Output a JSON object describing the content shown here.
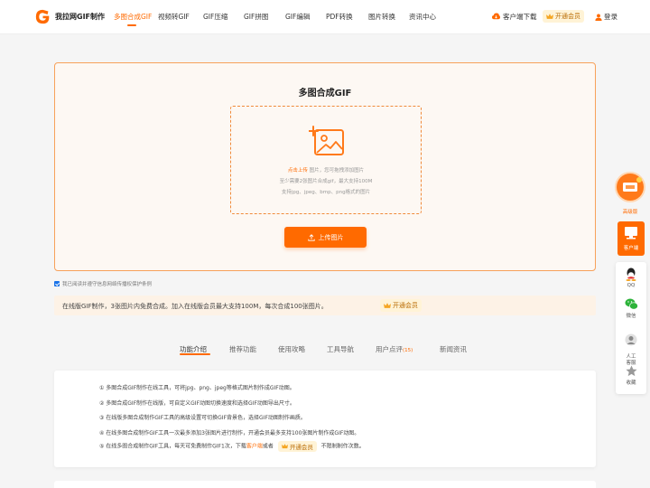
{
  "header": {
    "logo_text": "我拉网GIF制作",
    "nav": [
      {
        "label": "多图合成GIF",
        "active": true
      },
      {
        "label": "视频转GIF",
        "active": false
      },
      {
        "label": "GIF压缩",
        "active": false
      },
      {
        "label": "GIF拼图",
        "active": false
      },
      {
        "label": "GIF编辑",
        "active": false
      },
      {
        "label": "PDF转换",
        "active": false
      },
      {
        "label": "图片转换",
        "active": false
      },
      {
        "label": "资讯中心",
        "active": false
      }
    ],
    "client_download": "客户端下载",
    "vip_button": "开通会员",
    "login": "登录"
  },
  "upload": {
    "title": "多图合成GIF",
    "click_upload": "点击上传",
    "line1_rest": "图片，您可拖拽添加图片",
    "line2": "至少需要2张图片合成gif，最大支持100M",
    "line3": "支持jpg、jpeg、bmp、png格式的图片",
    "button": "上传图片"
  },
  "agreement": "我已阅读并遵守信息网络传播权保护条例",
  "notice": {
    "text": "在线版GIF制作，3张图片内免费合成。加入在线版会员最大支持100M，每次合成100张图片。",
    "vip": "开通会员"
  },
  "tabs": [
    {
      "label": "功能介绍",
      "active": true
    },
    {
      "label": "推荐功能",
      "active": false
    },
    {
      "label": "使用攻略",
      "active": false
    },
    {
      "label": "工具导航",
      "active": false
    },
    {
      "label": "用户点评",
      "count": "(15)",
      "active": false
    },
    {
      "label": "新闻资讯",
      "active": false
    }
  ],
  "intro": {
    "items": [
      "① 多图合成GIF制作在线工具，可将jpg、png、jpeg等格式图片制作成GIF动图。",
      "② 多图合成GIF制作在线版，可自定义GIF动图切换速度和选择GIF动图导出尺寸。",
      "③ 在线版多图合成制作GIF工具的高级设置可切换GIF背景色，选择GIF动图制作画质。",
      "④ 在线多图合成制作GIF工具一次最多添加3张图片进行制作，开通会员最多支持100张图片制作成GIF动图。"
    ],
    "item5_prefix": "⑤ 在线多图合成制作GIF工具，每天可免费制作GIF1次，下载",
    "item5_link": "客户端",
    "item5_mid": "或者",
    "item5_vip": "开通会员",
    "item5_suffix": "不限制制作次数。"
  },
  "sidebar": {
    "gift_label": "高级版",
    "client_label": "客户端",
    "items": [
      "QQ",
      "微信",
      "人工\n客服",
      "收藏"
    ]
  },
  "colors": {
    "accent": "#ff6a00",
    "panel_border": "#f7a15a",
    "vip_bg": "#fff3d6"
  }
}
